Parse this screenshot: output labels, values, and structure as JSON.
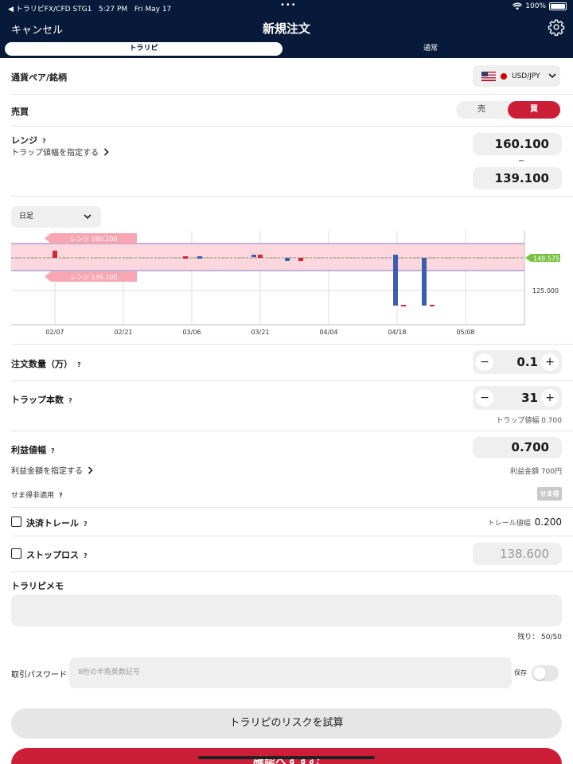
{
  "status_bar": {
    "carrier": "◀ トラリピFX/CFD STG1",
    "time": "5:27 PM",
    "date": "Fri May 17",
    "battery": "100%"
  },
  "header": {
    "cancel_label": "キャンセル",
    "title": "新規注文",
    "tabs": [
      {
        "label": "トラリピ",
        "selected": true
      },
      {
        "label": "通常",
        "selected": false
      }
    ]
  },
  "currency": {
    "label": "通貨ペア/銘柄",
    "pair": "USD/JPY"
  },
  "trade": {
    "label": "売買",
    "sell_label": "売",
    "buy_label": "買",
    "selected": "buy"
  },
  "range": {
    "label": "レンジ",
    "help": "?",
    "link_label": "トラップ値幅を指定する",
    "upper": "160.100",
    "tilde": "~",
    "lower": "139.100"
  },
  "chart_period": {
    "value": "日足"
  },
  "chart_data": {
    "type": "candlestick",
    "x_labels": [
      "02/07",
      "02/21",
      "03/06",
      "03/21",
      "04/04",
      "04/18",
      "05/08"
    ],
    "y_tick_labels": [
      "125.000"
    ],
    "current_price": "149.575",
    "range_upper_label": "レンジ 160.100",
    "range_lower_label": "レンジ 139.100",
    "range_upper": 160.1,
    "range_lower": 139.1,
    "colors": {
      "range_fill": "#fcd7de",
      "range_line": "#9d8fcf",
      "up": "#d0283b",
      "down": "#3e5dae",
      "price_tag": "#7bc043"
    }
  },
  "quantity": {
    "label": "注文数量（万）",
    "help": "?",
    "value": "0.1",
    "minus": "−",
    "plus": "+"
  },
  "traps": {
    "label": "トラップ本数",
    "help": "?",
    "value": "31",
    "minus": "−",
    "plus": "+",
    "note": "トラップ値幅 0.700"
  },
  "profit": {
    "label": "利益値幅",
    "help": "?",
    "value": "0.700",
    "link_label": "利益金額を指定する",
    "note": "利益金額 700円"
  },
  "semae": {
    "label": "せま得非適用",
    "help": "?",
    "badge": "せま得"
  },
  "trail": {
    "label": "決済トレール",
    "help": "?",
    "note_label": "トレール値幅",
    "note_value": "0.200"
  },
  "stoploss": {
    "label": "ストップロス",
    "help": "?",
    "value": "138.600"
  },
  "memo": {
    "label": "トラリピメモ",
    "counter": "残り： 50/50"
  },
  "password": {
    "label": "取引パスワード",
    "placeholder": "8桁の半角英数記号",
    "save_label": "保存"
  },
  "buttons": {
    "risk_label": "トラリピのリスクを試算",
    "confirm_label": "確認へすすむ"
  }
}
